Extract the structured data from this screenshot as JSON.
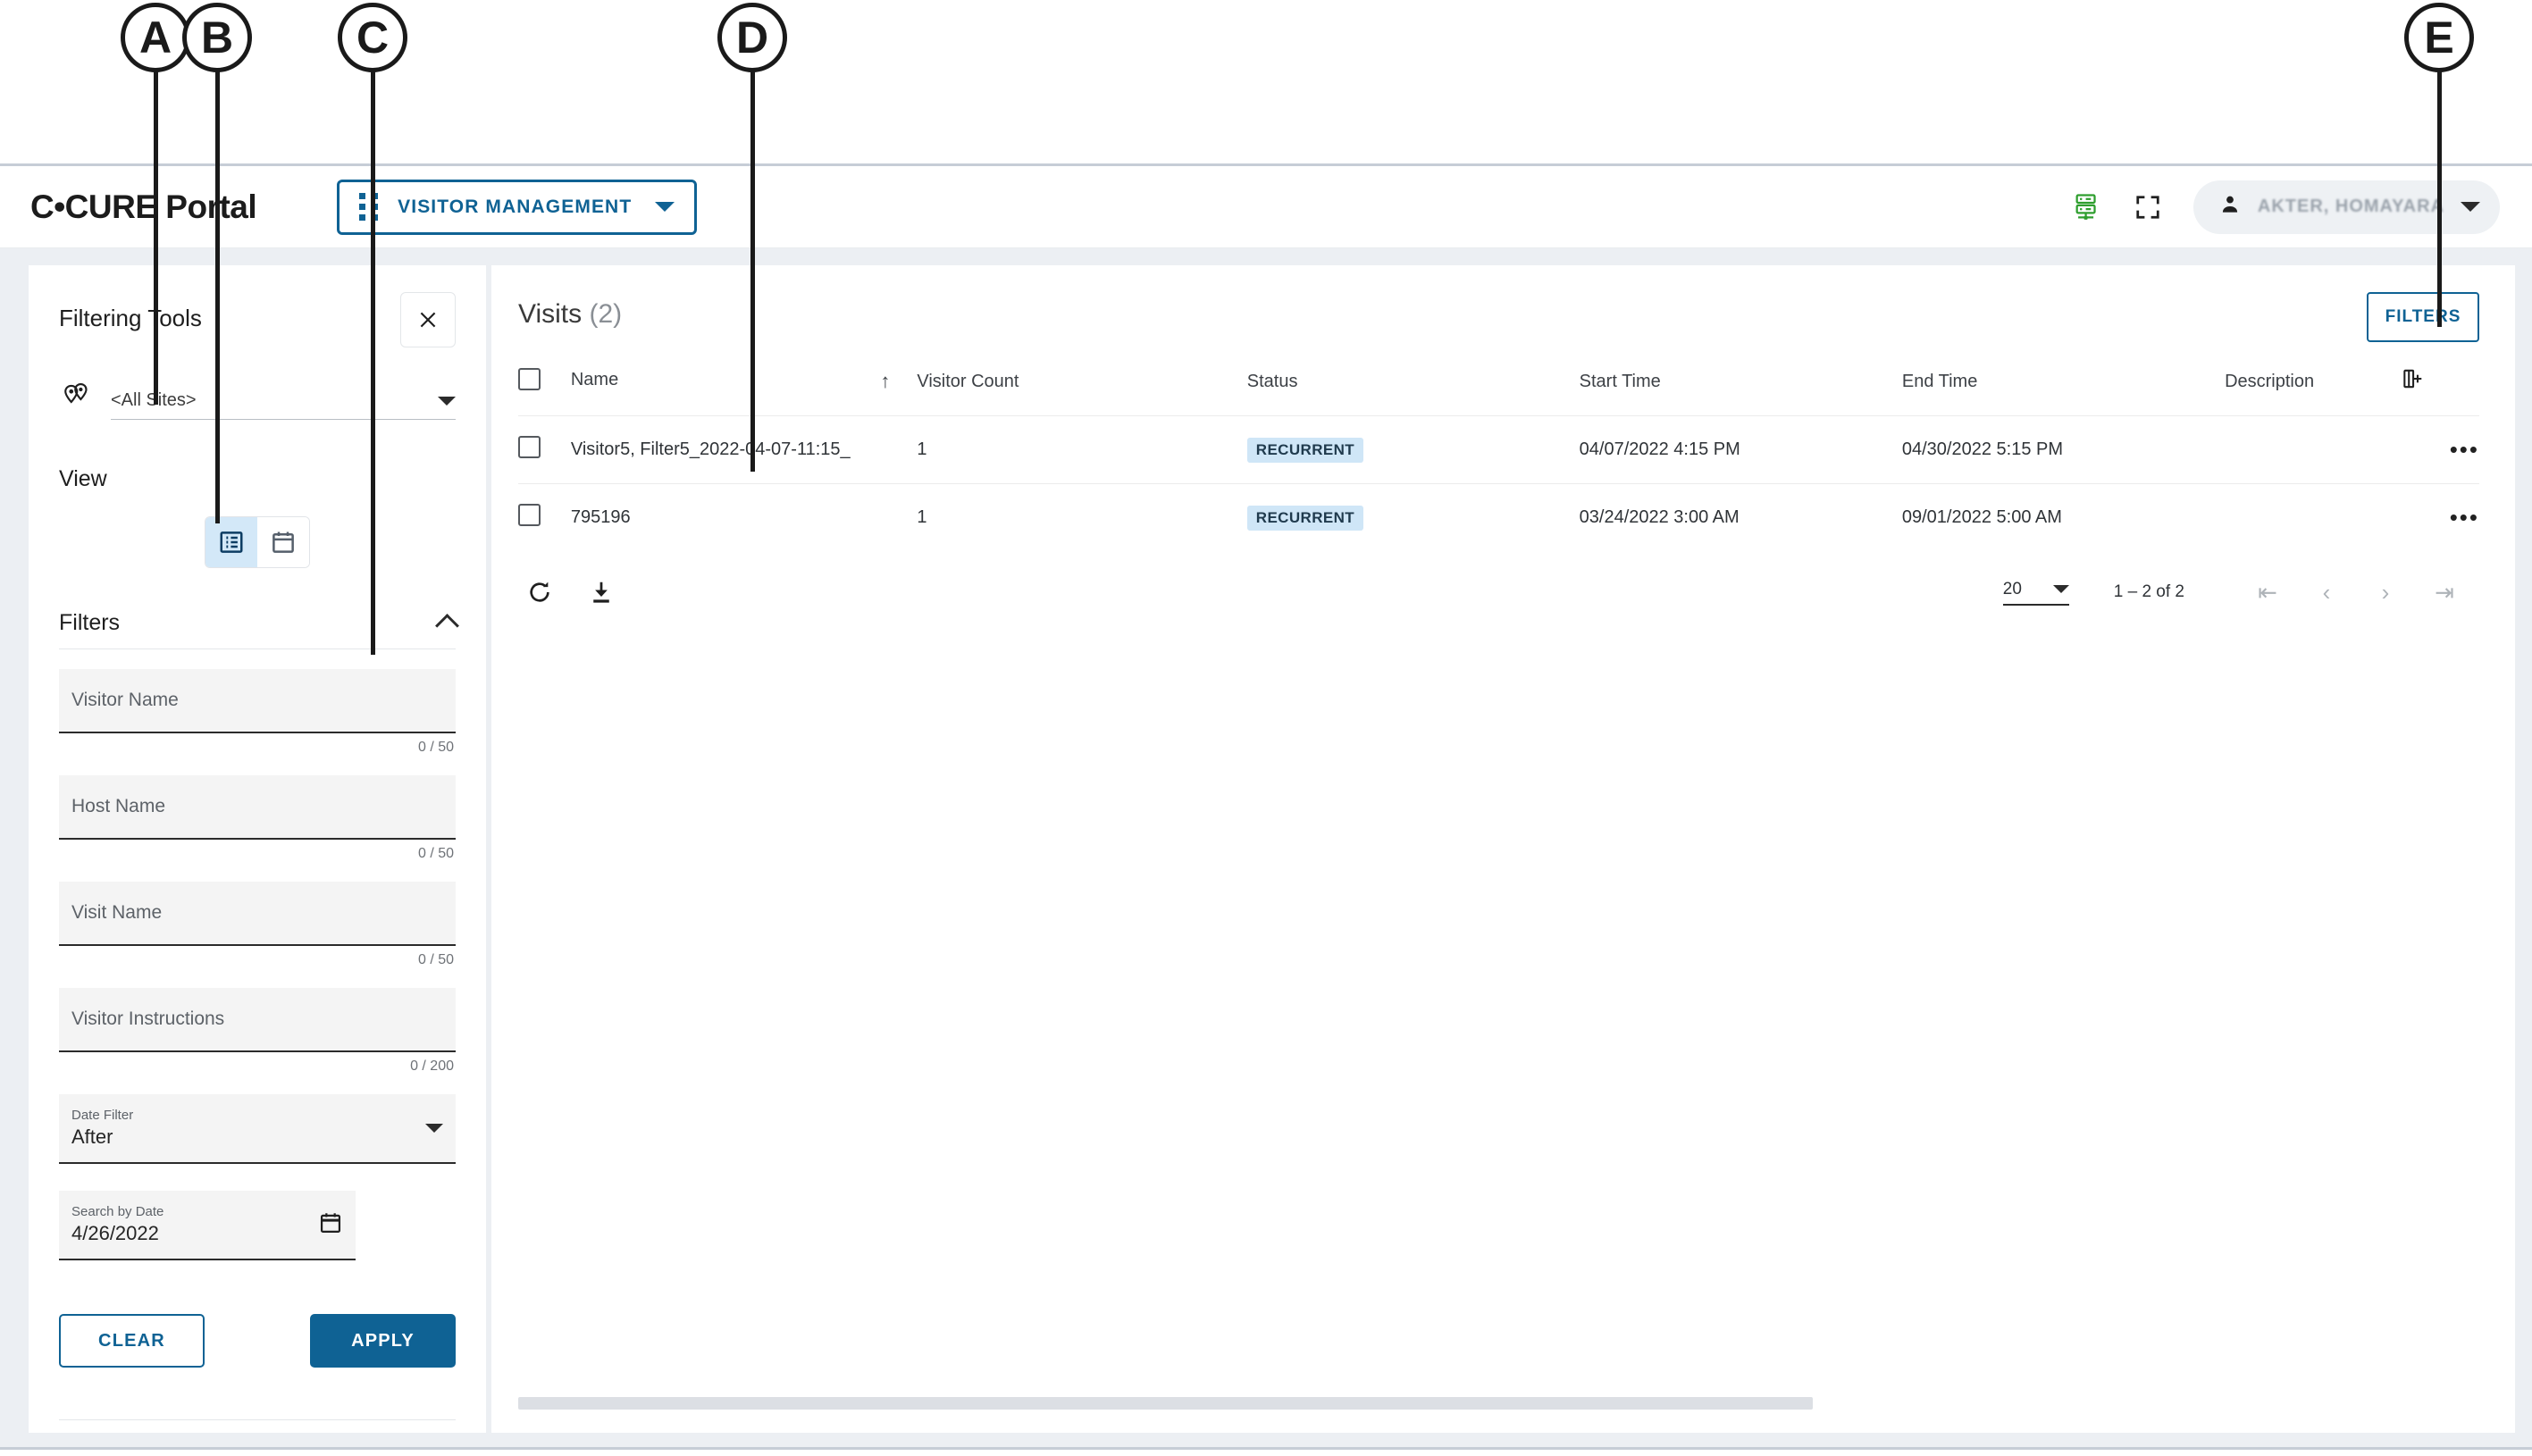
{
  "callouts": [
    {
      "label": "A"
    },
    {
      "label": "B"
    },
    {
      "label": "C"
    },
    {
      "label": "D"
    },
    {
      "label": "E"
    }
  ],
  "topbar": {
    "brand": "C•CURE Portal",
    "module_label": "VISITOR MANAGEMENT",
    "module_icon": "grid-dots-icon",
    "caret_icon": "chevron-down-icon",
    "server_icon": "server-status-icon",
    "fullscreen_icon": "fullscreen-icon",
    "user_icon": "person-icon",
    "user_name": "AKTER, HOMAYARA",
    "user_caret_icon": "chevron-down-icon"
  },
  "filter_panel": {
    "title": "Filtering Tools",
    "close_icon": "close-icon",
    "site_icon": "map-pins-icon",
    "site_value": "<All Sites>",
    "site_caret_icon": "chevron-down-icon",
    "view_label": "View",
    "view_toggle": [
      {
        "icon": "list-view-icon",
        "active": true
      },
      {
        "icon": "calendar-view-icon",
        "active": false
      }
    ],
    "filters_label": "Filters",
    "collapse_icon": "chevron-up-icon",
    "fields": [
      {
        "placeholder": "Visitor Name",
        "value": "",
        "counter": "0 / 50"
      },
      {
        "placeholder": "Host Name",
        "value": "",
        "counter": "0 / 50"
      },
      {
        "placeholder": "Visit Name",
        "value": "",
        "counter": "0 / 50"
      },
      {
        "placeholder": "Visitor Instructions",
        "value": "",
        "counter": "0 / 200"
      }
    ],
    "date_filter": {
      "label": "Date Filter",
      "value": "After",
      "caret_icon": "chevron-down-icon"
    },
    "search_by_date": {
      "label": "Search by Date",
      "value": "4/26/2022",
      "icon": "calendar-icon"
    },
    "clear_label": "CLEAR",
    "apply_label": "APPLY"
  },
  "content": {
    "title": "Visits",
    "count": "(2)",
    "filters_button": "FILTERS",
    "columns": [
      "Name",
      "Visitor Count",
      "Status",
      "Start Time",
      "End Time",
      "Description"
    ],
    "sort_icon": "sort-ascending-icon",
    "add_column_icon": "add-column-icon",
    "row_menu_icon": "overflow-menu-icon",
    "rows": [
      {
        "name": "Visitor5, Filter5_2022-04-07-11:15_",
        "visitor_count": "1",
        "status": "RECURRENT",
        "start_time": "04/07/2022 4:15 PM",
        "end_time": "04/30/2022 5:15 PM",
        "description": ""
      },
      {
        "name": "795196",
        "visitor_count": "1",
        "status": "RECURRENT",
        "start_time": "03/24/2022 3:00 AM",
        "end_time": "09/01/2022 5:00 AM",
        "description": ""
      }
    ],
    "toolbar": {
      "refresh_icon": "refresh-icon",
      "download_icon": "download-icon"
    },
    "pagination": {
      "page_size": "20",
      "page_size_caret_icon": "chevron-down-icon",
      "range": "1 – 2 of 2",
      "first_icon": "first-page-icon",
      "prev_icon": "previous-page-icon",
      "next_icon": "next-page-icon",
      "last_icon": "last-page-icon"
    }
  },
  "colors": {
    "accent": "#0f6294",
    "badge_bg": "#cfe6f7",
    "toggle_active_bg": "#d3e8f8",
    "app_bg": "#eceff3",
    "green_icon": "#2e9e2e"
  }
}
